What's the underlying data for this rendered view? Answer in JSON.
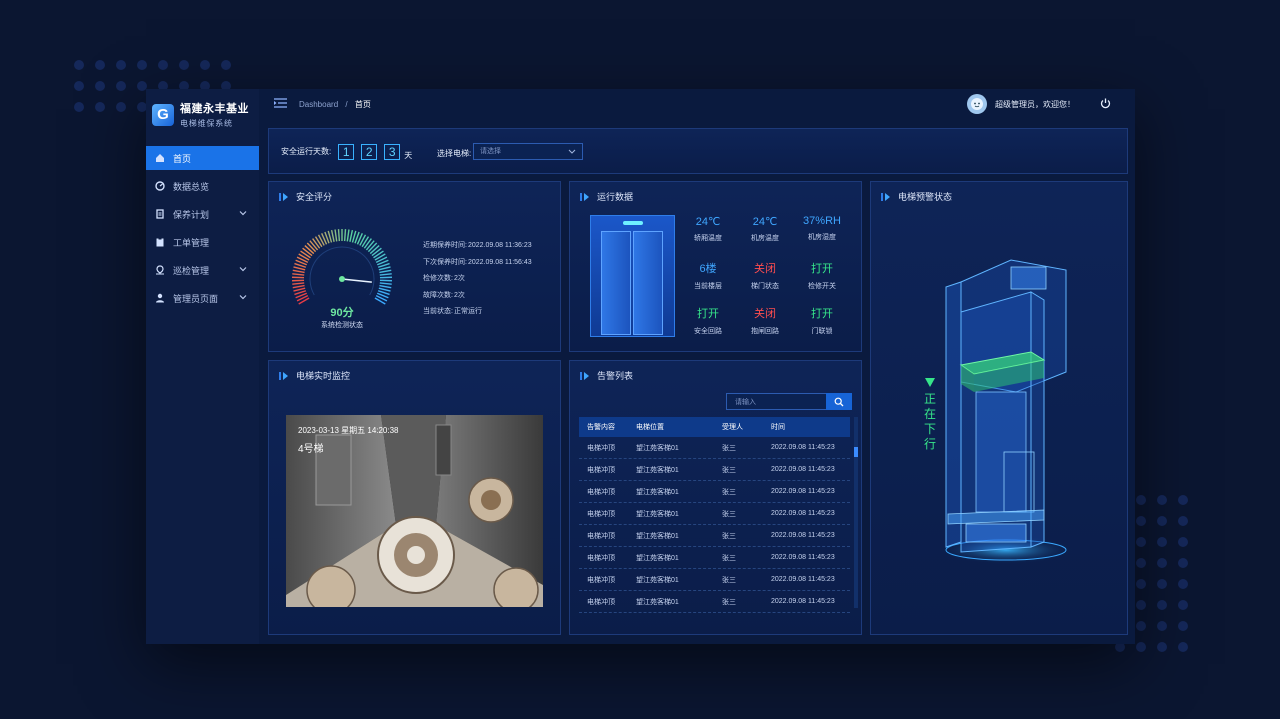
{
  "app": {
    "name": "福建永丰基业",
    "subtitle": "电梯维保系统",
    "logo_letter": "G"
  },
  "sidebar": {
    "items": [
      {
        "label": "首页",
        "icon": "home-icon",
        "active": true
      },
      {
        "label": "数据总览",
        "icon": "dashboard-icon"
      },
      {
        "label": "保养计划",
        "icon": "document-icon",
        "expandable": true
      },
      {
        "label": "工单管理",
        "icon": "clipboard-icon"
      },
      {
        "label": "巡检管理",
        "icon": "location-icon",
        "expandable": true
      },
      {
        "label": "管理员页面",
        "icon": "admin-icon",
        "expandable": true
      }
    ]
  },
  "topbar": {
    "breadcrumb_root": "Dashboard",
    "breadcrumb_sep": "/",
    "breadcrumb_current": "首页",
    "welcome": "超级管理员，欢迎您！"
  },
  "filter": {
    "days_label": "安全运行天数:",
    "days_digits": [
      "1",
      "2",
      "3"
    ],
    "days_unit": "天",
    "select_label": "选择电梯:",
    "select_placeholder": "请选择"
  },
  "safety": {
    "title": "安全评分",
    "score": 90,
    "score_text": "90分",
    "score_caption": "系统检测状态",
    "info": [
      {
        "label": "近期保养时间:",
        "value": "2022.09.08 11:36:23"
      },
      {
        "label": "下次保养时间:",
        "value": "2022.09.08 11:56:43"
      },
      {
        "label": "检修次数:",
        "value": "2次"
      },
      {
        "label": "故障次数:",
        "value": "2次"
      },
      {
        "label": "当前状态:",
        "value": "正常运行"
      }
    ]
  },
  "runtime": {
    "title": "运行数据",
    "stats": [
      {
        "value": "24℃",
        "label": "轿厢温度",
        "color": "blue"
      },
      {
        "value": "24℃",
        "label": "机房温度",
        "color": "blue"
      },
      {
        "value": "37%RH",
        "label": "机房湿度",
        "color": "blue"
      },
      {
        "value": "6楼",
        "label": "当前楼层",
        "color": "blue"
      },
      {
        "value": "关闭",
        "label": "梯门状态",
        "color": "red"
      },
      {
        "value": "打开",
        "label": "检修开关",
        "color": "green"
      },
      {
        "value": "打开",
        "label": "安全回路",
        "color": "green"
      },
      {
        "value": "关闭",
        "label": "抱闸回路",
        "color": "red"
      },
      {
        "value": "打开",
        "label": "门联锁",
        "color": "green"
      }
    ]
  },
  "warning_status": {
    "title": "电梯预警状态",
    "status": "正在下行"
  },
  "monitor": {
    "title": "电梯实时监控",
    "timestamp": "2023-03-13   星期五   14:20:38",
    "camera_label": "4号梯"
  },
  "alarms": {
    "title": "告警列表",
    "search_placeholder": "请输入",
    "columns": [
      "告警内容",
      "电梯位置",
      "受理人",
      "时间"
    ],
    "rows": [
      [
        "电梯冲顶",
        "望江苑客梯01",
        "张三",
        "2022.09.08 11:45:23"
      ],
      [
        "电梯冲顶",
        "望江苑客梯01",
        "张三",
        "2022.09.08 11:45:23"
      ],
      [
        "电梯冲顶",
        "望江苑客梯01",
        "张三",
        "2022.09.08 11:45:23"
      ],
      [
        "电梯冲顶",
        "望江苑客梯01",
        "张三",
        "2022.09.08 11:45:23"
      ],
      [
        "电梯冲顶",
        "望江苑客梯01",
        "张三",
        "2022.09.08 11:45:23"
      ],
      [
        "电梯冲顶",
        "望江苑客梯01",
        "张三",
        "2022.09.08 11:45:23"
      ],
      [
        "电梯冲顶",
        "望江苑客梯01",
        "张三",
        "2022.09.08 11:45:23"
      ],
      [
        "电梯冲顶",
        "望江苑客梯01",
        "张三",
        "2022.09.08 11:45:23"
      ]
    ]
  },
  "colors": {
    "background": "#0b1631",
    "accent": "#1a73e8",
    "green": "#36e58a",
    "red": "#ff4d4f",
    "blue": "#3fa6ff"
  }
}
